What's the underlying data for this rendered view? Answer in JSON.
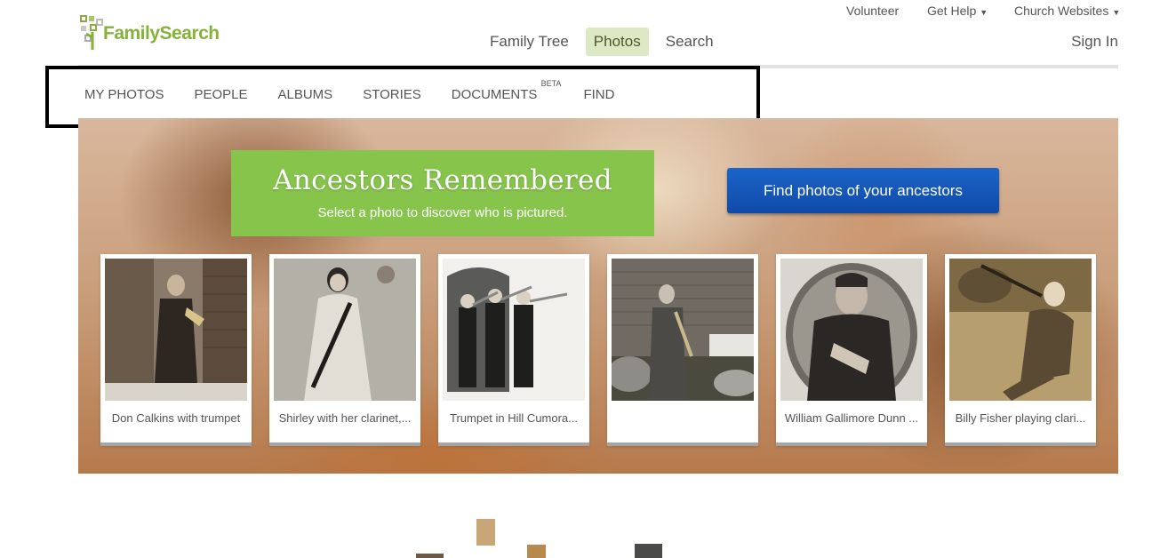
{
  "brand": {
    "name": "FamilySearch"
  },
  "utility_nav": {
    "volunteer": "Volunteer",
    "get_help": "Get Help",
    "church_websites": "Church Websites"
  },
  "main_nav": {
    "family_tree": "Family Tree",
    "photos": "Photos",
    "search": "Search",
    "sign_in": "Sign In"
  },
  "sub_nav": {
    "my_photos": "MY PHOTOS",
    "people": "PEOPLE",
    "albums": "ALBUMS",
    "stories": "STORIES",
    "documents": "DOCUMENTS",
    "documents_badge": "BETA",
    "find": "FIND"
  },
  "hero": {
    "title": "Ancestors Remembered",
    "subtitle": "Select a photo to discover who is pictured.",
    "cta": "Find photos of your ancestors"
  },
  "photo_cards": [
    {
      "caption": "Don Calkins with trumpet"
    },
    {
      "caption": "Shirley with her clarinet,..."
    },
    {
      "caption": "Trumpet in Hill Cumora..."
    },
    {
      "caption": ""
    },
    {
      "caption": "William Gallimore Dunn ..."
    },
    {
      "caption": "Billy Fisher playing clari..."
    }
  ],
  "colors": {
    "brand_green": "#86b23b",
    "banner_green": "#86c44c",
    "cta_blue": "#1a5cc0",
    "nav_active_bg": "#dde9c5"
  }
}
